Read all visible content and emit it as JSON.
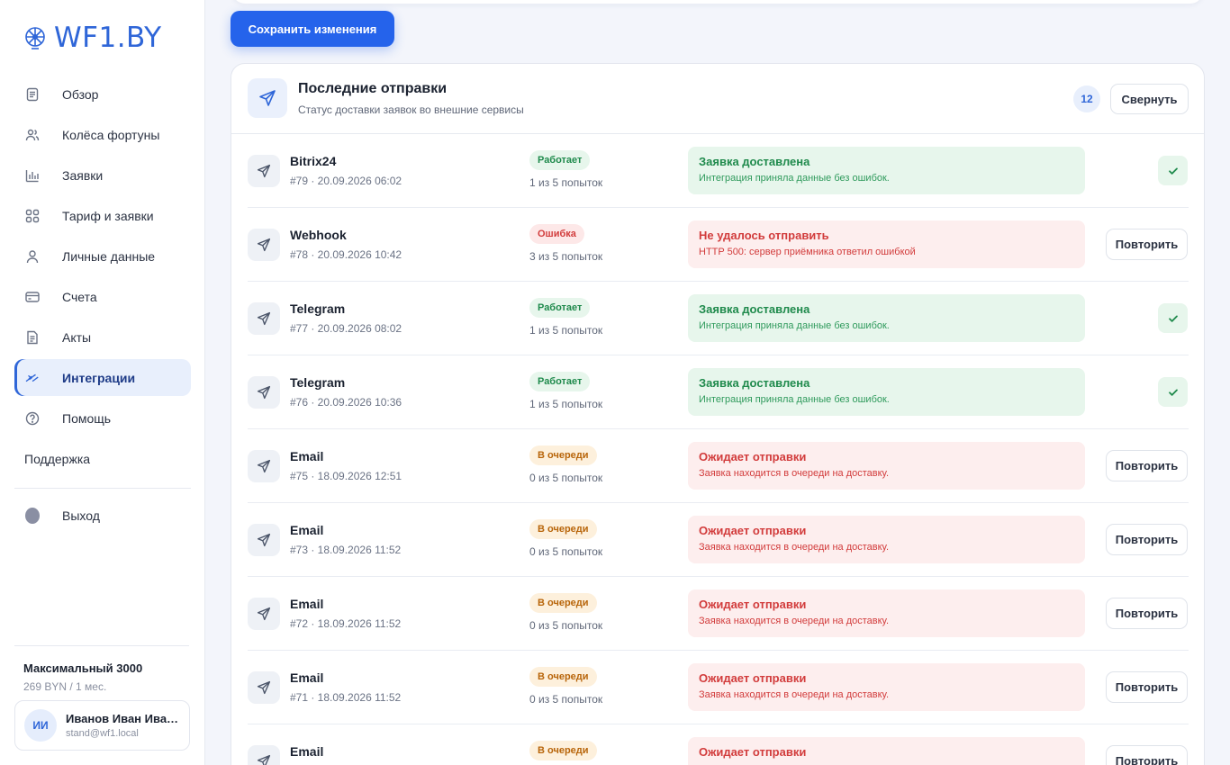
{
  "brand": {
    "name": "WF1.BY",
    "accent": "#2563eb"
  },
  "sidebar": {
    "items": [
      {
        "key": "overview",
        "label": "Обзор",
        "icon": "document-icon",
        "active": false
      },
      {
        "key": "wheels",
        "label": "Колёса фортуны",
        "icon": "users-icon",
        "active": false
      },
      {
        "key": "requests",
        "label": "Заявки",
        "icon": "bar-chart-icon",
        "active": false
      },
      {
        "key": "tariff",
        "label": "Тариф и заявки",
        "icon": "grid-icon",
        "active": false
      },
      {
        "key": "profile",
        "label": "Личные данные",
        "icon": "user-icon",
        "active": false
      },
      {
        "key": "invoices",
        "label": "Счета",
        "icon": "card-icon",
        "active": false
      },
      {
        "key": "acts",
        "label": "Акты",
        "icon": "file-icon",
        "active": false
      },
      {
        "key": "integrations",
        "label": "Интеграции",
        "icon": "link-icon",
        "active": true
      },
      {
        "key": "help",
        "label": "Помощь",
        "icon": "help-icon",
        "active": false
      }
    ],
    "support_label": "Поддержка",
    "logout_label": "Выход",
    "plan_name": "Максимальный 3000",
    "plan_price": "269 BYN / 1 мес.",
    "user": {
      "initials": "ИИ",
      "name": "Иванов Иван Иванович",
      "email": "stand@wf1.local"
    }
  },
  "toolbar": {
    "save_label": "Сохранить изменения"
  },
  "panel": {
    "title": "Последние отправки",
    "subtitle": "Статус доставки заявок во внешние сервисы",
    "count": "12",
    "collapse_label": "Свернуть"
  },
  "deliveries": [
    {
      "service": "Bitrix24",
      "meta": "#79 · 20.09.2026 06:02",
      "status": "Работает",
      "status_kind": "ok",
      "attempts": "1 из 5 попыток",
      "msg_title": "Заявка доставлена",
      "msg_desc": "Интеграция приняла данные без ошибок.",
      "action": "check"
    },
    {
      "service": "Webhook",
      "meta": "#78 · 20.09.2026 10:42",
      "status": "Ошибка",
      "status_kind": "err",
      "attempts": "3 из 5 попыток",
      "msg_title": "Не удалось отправить",
      "msg_desc": "HTTP 500: сервер приёмника ответил ошибкой",
      "action": "retry"
    },
    {
      "service": "Telegram",
      "meta": "#77 · 20.09.2026 08:02",
      "status": "Работает",
      "status_kind": "ok",
      "attempts": "1 из 5 попыток",
      "msg_title": "Заявка доставлена",
      "msg_desc": "Интеграция приняла данные без ошибок.",
      "action": "check"
    },
    {
      "service": "Telegram",
      "meta": "#76 · 20.09.2026 10:36",
      "status": "Работает",
      "status_kind": "ok",
      "attempts": "1 из 5 попыток",
      "msg_title": "Заявка доставлена",
      "msg_desc": "Интеграция приняла данные без ошибок.",
      "action": "check"
    },
    {
      "service": "Email",
      "meta": "#75 · 18.09.2026 12:51",
      "status": "В очереди",
      "status_kind": "queue",
      "attempts": "0 из 5 попыток",
      "msg_title": "Ожидает отправки",
      "msg_desc": "Заявка находится в очереди на доставку.",
      "action": "retry"
    },
    {
      "service": "Email",
      "meta": "#73 · 18.09.2026 11:52",
      "status": "В очереди",
      "status_kind": "queue",
      "attempts": "0 из 5 попыток",
      "msg_title": "Ожидает отправки",
      "msg_desc": "Заявка находится в очереди на доставку.",
      "action": "retry"
    },
    {
      "service": "Email",
      "meta": "#72 · 18.09.2026 11:52",
      "status": "В очереди",
      "status_kind": "queue",
      "attempts": "0 из 5 попыток",
      "msg_title": "Ожидает отправки",
      "msg_desc": "Заявка находится в очереди на доставку.",
      "action": "retry"
    },
    {
      "service": "Email",
      "meta": "#71 · 18.09.2026 11:52",
      "status": "В очереди",
      "status_kind": "queue",
      "attempts": "0 из 5 попыток",
      "msg_title": "Ожидает отправки",
      "msg_desc": "Заявка находится в очереди на доставку.",
      "action": "retry"
    },
    {
      "service": "Email",
      "meta": "",
      "status": "В очереди",
      "status_kind": "queue",
      "attempts": "",
      "msg_title": "Ожидает отправки",
      "msg_desc": "",
      "action": "retry"
    }
  ],
  "retry_label": "Повторить"
}
